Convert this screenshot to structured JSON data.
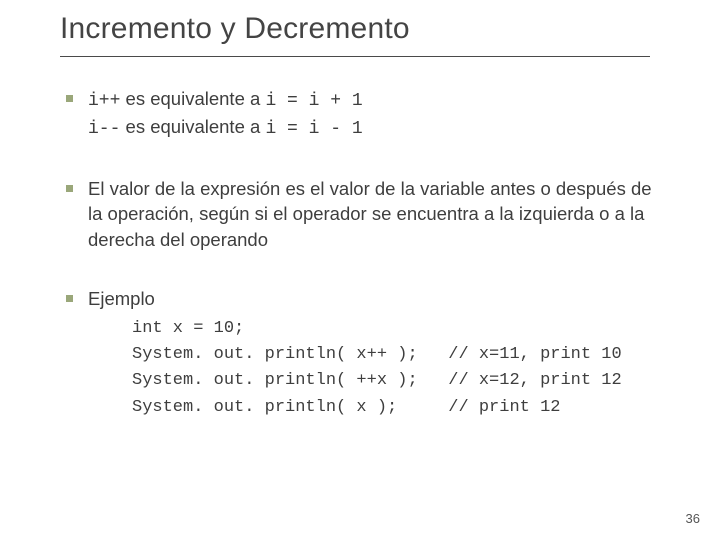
{
  "title": "Incremento y Decremento",
  "bullet1": {
    "line1_code1": "i++",
    "line1_text": " es equivalente a ",
    "line1_code2": "i = i + 1",
    "line2_code1": "i--",
    "line2_text": " es equivalente a ",
    "line2_code2": "i = i - 1"
  },
  "bullet2": "El valor de la expresión es el valor de la variable antes o después de la operación, según si el operador se encuentra a la izquierda o a la derecha del operando",
  "bullet3": {
    "label": "Ejemplo",
    "code": "int x = 10;\nSystem. out. println( x++ );   // x=11, print 10\nSystem. out. println( ++x );   // x=12, print 12\nSystem. out. println( x );     // print 12"
  },
  "page_number": "36"
}
